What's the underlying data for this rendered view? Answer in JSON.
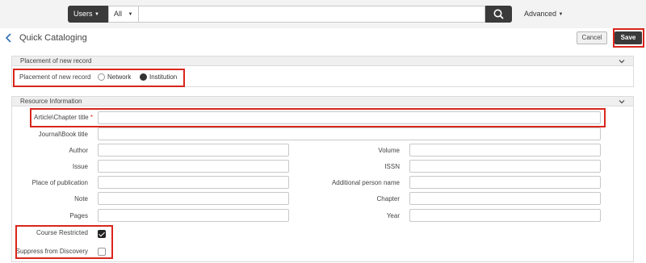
{
  "search": {
    "scope_label": "Users",
    "filter_label": "All",
    "query_value": "",
    "advanced_label": "Advanced"
  },
  "page": {
    "title": "Quick Cataloging",
    "cancel_label": "Cancel",
    "save_label": "Save"
  },
  "placement": {
    "section_title": "Placement of new record",
    "field_label": "Placement of new record",
    "options": [
      {
        "label": "Network",
        "selected": false
      },
      {
        "label": "Institution",
        "selected": true
      }
    ]
  },
  "resource": {
    "section_title": "Resource Information",
    "article_title": {
      "label": "Article\\Chapter title",
      "required_mark": "*",
      "value": ""
    },
    "journal_title": {
      "label": "Journal\\Book title",
      "value": ""
    },
    "fields_left": [
      {
        "label": "Author",
        "value": ""
      },
      {
        "label": "Issue",
        "value": ""
      },
      {
        "label": "Place of publication",
        "value": ""
      },
      {
        "label": "Note",
        "value": ""
      },
      {
        "label": "Pages",
        "value": ""
      }
    ],
    "fields_right": [
      {
        "label": "Volume",
        "value": ""
      },
      {
        "label": "ISSN",
        "value": ""
      },
      {
        "label": "Additional person name",
        "value": ""
      },
      {
        "label": "Chapter",
        "value": ""
      },
      {
        "label": "Year",
        "value": ""
      }
    ],
    "course_restricted": {
      "label": "Course Restricted",
      "checked": true
    },
    "suppress_discovery": {
      "label": "Suppress from Discovery",
      "checked": false
    }
  },
  "colors": {
    "highlight": "#d9261c",
    "dark_button": "#3a3a3a"
  }
}
